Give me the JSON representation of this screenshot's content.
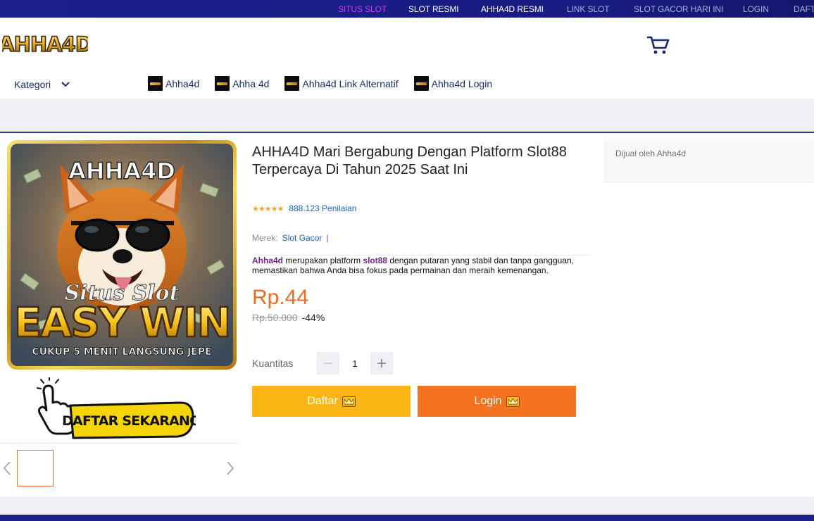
{
  "topnav": {
    "items": [
      {
        "label": "SITUS SLOT",
        "color": "#d43cf0"
      },
      {
        "label": "SLOT RESMI",
        "color": "#ffffff"
      },
      {
        "label": "AHHA4D RESMI",
        "color": "#ffffff"
      },
      {
        "label": "LINK SLOT",
        "color": "#a9aedc"
      },
      {
        "label": "SLOT GACOR HARI INI",
        "color": "#a9aedc"
      },
      {
        "label": "LOGIN",
        "color": "#a9aedc"
      },
      {
        "label": "DAFT",
        "color": "#a9aedc"
      }
    ]
  },
  "header": {
    "logo_text": "AHHA4D",
    "cart_icon": "cart-icon"
  },
  "categories": {
    "label": "Kategori",
    "links": [
      "Ahha4d",
      "Ahha 4d",
      "Ahha4d Link Alternatif",
      "Ahha4d Login"
    ]
  },
  "product": {
    "image": {
      "brand_text": "AHHA4D",
      "script_text": "Situs Slot",
      "headline": "EASY WIN",
      "subline": "CUKUP 5 MENIT LANGSUNG JEPE"
    },
    "banner_text": "DAFTAR SEKARANG",
    "title": "AHHA4D Mari Bergabung Dengan Platform Slot88 Terpercaya Di Tahun 2025 Saat Ini",
    "stars": "★★★★★",
    "rating_value": 5,
    "review_count": "888.123 Penilaian",
    "brand_label": "Merek:",
    "brand_value": "Slot Gacor",
    "brand_sep": "|",
    "description": {
      "bold1": "Ahha4d",
      "text1": " merupakan platform ",
      "bold2": "slot88",
      "text2": " dengan putaran yang stabil dan tanpa gangguan, memastikan bahwa Anda bisa fokus pada permainan dan meraih kemenangan."
    },
    "price": "Rp.44",
    "old_price": "Rp.50.000",
    "discount": "-44%",
    "quantity_label": "Kuantitas",
    "quantity_value": "1",
    "buttons": {
      "daftar": "Daftar",
      "login": "Login"
    }
  },
  "seller": {
    "text": "Dijual oleh Ahha4d"
  },
  "colors": {
    "navy": "#1a1f8c",
    "orange": "#f06b22",
    "yellow": "#fbb615",
    "link": "#1a62c6"
  }
}
